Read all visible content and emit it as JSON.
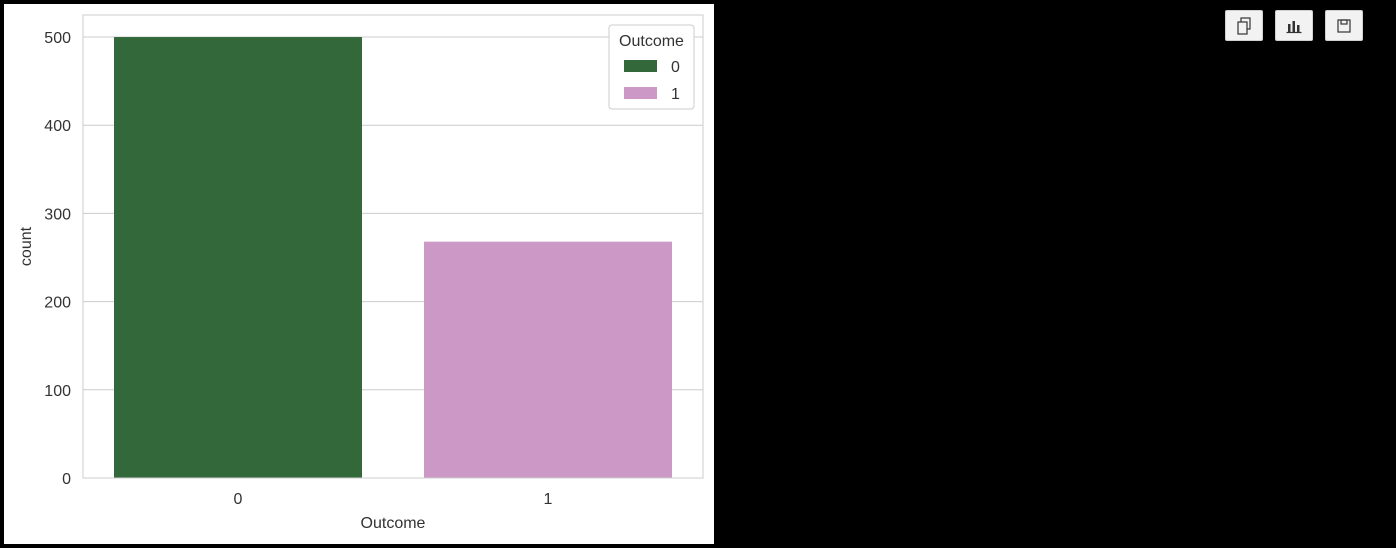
{
  "toolbar": {
    "buttons": [
      {
        "icon": "copy-icon"
      },
      {
        "icon": "bar-chart-icon"
      },
      {
        "icon": "save-icon"
      }
    ]
  },
  "chart_data": {
    "type": "bar",
    "categories": [
      "0",
      "1"
    ],
    "values": [
      500,
      268
    ],
    "colors": [
      "#33693a",
      "#cc99c6"
    ],
    "xlabel": "Outcome",
    "ylabel": "count",
    "ylim": [
      0,
      525
    ],
    "yticks": [
      0,
      100,
      200,
      300,
      400,
      500
    ],
    "grid": true,
    "legend": {
      "title": "Outcome",
      "placement": "top-right",
      "entries": [
        "0",
        "1"
      ]
    }
  }
}
